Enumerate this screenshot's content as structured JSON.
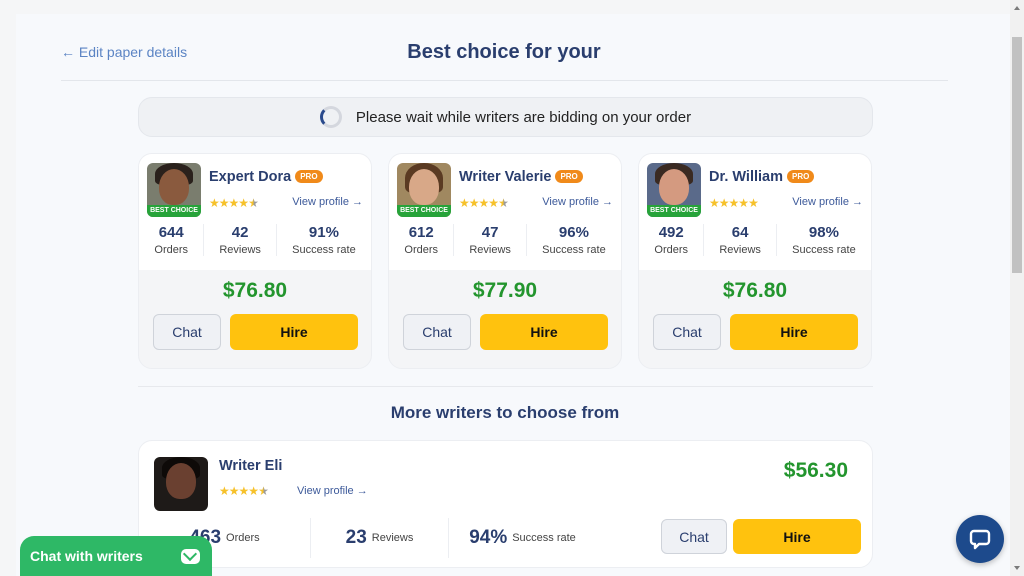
{
  "header": {
    "back_link": "← Edit paper details",
    "title": "Best choice for your"
  },
  "status": {
    "wait_message": "Please wait while writers are bidding on your order"
  },
  "top_writers": [
    {
      "name": "Expert Dora",
      "pro_label": "PRO",
      "best_choice_label": "BEST CHOICE",
      "rating": 4.5,
      "view_profile": "View profile →",
      "stats": [
        {
          "value": "644",
          "label": "Orders"
        },
        {
          "value": "42",
          "label": "Reviews"
        },
        {
          "value": "91%",
          "label": "Success rate"
        }
      ],
      "price": "$76.80",
      "chat_label": "Chat",
      "hire_label": "Hire"
    },
    {
      "name": "Writer Valerie",
      "pro_label": "PRO",
      "best_choice_label": "BEST CHOICE",
      "rating": 4.8,
      "view_profile": "View profile →",
      "stats": [
        {
          "value": "612",
          "label": "Orders"
        },
        {
          "value": "47",
          "label": "Reviews"
        },
        {
          "value": "96%",
          "label": "Success rate"
        }
      ],
      "price": "$77.90",
      "chat_label": "Chat",
      "hire_label": "Hire"
    },
    {
      "name": "Dr. William",
      "pro_label": "PRO",
      "best_choice_label": "BEST CHOICE",
      "rating": 5,
      "view_profile": "View profile →",
      "stats": [
        {
          "value": "492",
          "label": "Orders"
        },
        {
          "value": "64",
          "label": "Reviews"
        },
        {
          "value": "98%",
          "label": "Success rate"
        }
      ],
      "price": "$76.80",
      "chat_label": "Chat",
      "hire_label": "Hire"
    }
  ],
  "more_section": {
    "title": "More writers to choose from",
    "writers": [
      {
        "name": "Writer Eli",
        "rating": 4.7,
        "view_profile": "View profile →",
        "price": "$56.30",
        "stats": [
          {
            "value": "463",
            "label": "Orders"
          },
          {
            "value": "23",
            "label": "Reviews"
          },
          {
            "value": "94%",
            "label": "Success rate"
          }
        ],
        "chat_label": "Chat",
        "hire_label": "Hire"
      }
    ]
  },
  "widgets": {
    "chat_with_writers": "Chat with writers",
    "support_icon": "chat-bubble-icon",
    "mail_icon": "mail-icon"
  },
  "colors": {
    "primary_text": "#2a3e6e",
    "price_green": "#23952e",
    "hire_yellow": "#ffc20e",
    "pro_orange": "#f08a1a",
    "best_choice_green": "#27a33a",
    "chat_widget_green": "#2eb866",
    "support_blue": "#1d4a8c"
  }
}
